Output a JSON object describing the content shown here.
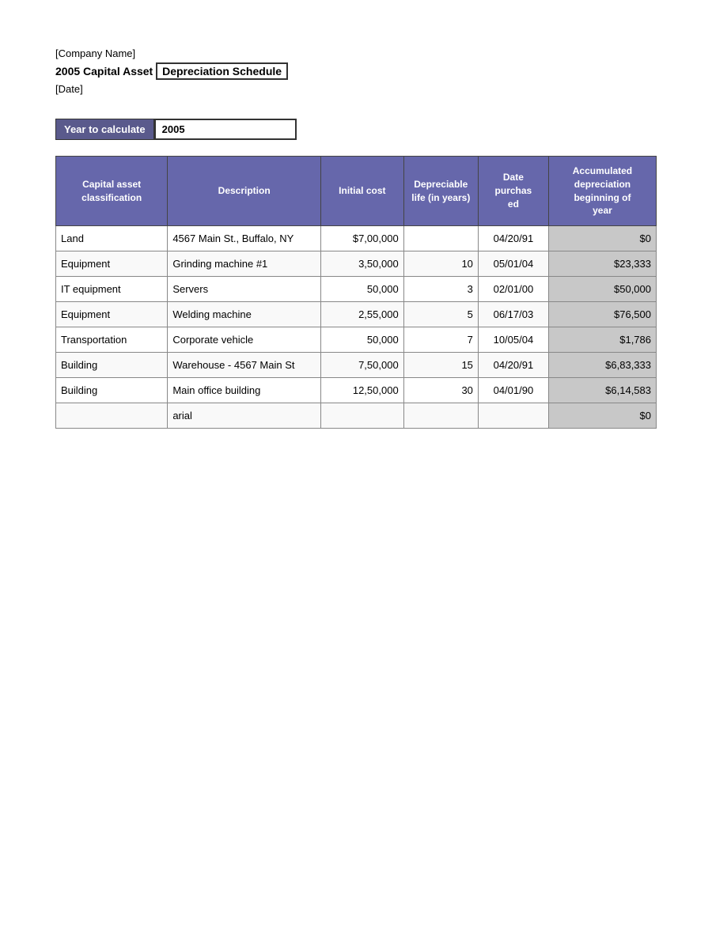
{
  "header": {
    "company_name": "[Company Name]",
    "report_title_prefix": "2005 Capital Asset",
    "report_title_box": "Depreciation Schedule",
    "report_date": "[Date]"
  },
  "year_section": {
    "label": "Year to calculate",
    "value": "2005"
  },
  "table": {
    "columns": [
      {
        "key": "classification",
        "label": "Capital asset classification"
      },
      {
        "key": "description",
        "label": "Description"
      },
      {
        "key": "initial_cost",
        "label": "Initial cost"
      },
      {
        "key": "depreciable_life",
        "label": "Depreciable life (in years)"
      },
      {
        "key": "date_purchased",
        "label": "Date purchased"
      },
      {
        "key": "accumulated",
        "label": "Accumulated depreciation beginning of year"
      }
    ],
    "rows": [
      {
        "classification": "Land",
        "description": "4567 Main St., Buffalo, NY",
        "initial_cost": "$7,00,000",
        "depreciable_life": "",
        "date_purchased": "04/20/91",
        "accumulated": "$0"
      },
      {
        "classification": "Equipment",
        "description": "Grinding machine #1",
        "initial_cost": "3,50,000",
        "depreciable_life": "10",
        "date_purchased": "05/01/04",
        "accumulated": "$23,333"
      },
      {
        "classification": "IT equipment",
        "description": "Servers",
        "initial_cost": "50,000",
        "depreciable_life": "3",
        "date_purchased": "02/01/00",
        "accumulated": "$50,000"
      },
      {
        "classification": "Equipment",
        "description": "Welding machine",
        "initial_cost": "2,55,000",
        "depreciable_life": "5",
        "date_purchased": "06/17/03",
        "accumulated": "$76,500"
      },
      {
        "classification": "Transportation",
        "description": "Corporate vehicle",
        "initial_cost": "50,000",
        "depreciable_life": "7",
        "date_purchased": "10/05/04",
        "accumulated": "$1,786"
      },
      {
        "classification": "Building",
        "description": "Warehouse - 4567 Main St",
        "initial_cost": "7,50,000",
        "depreciable_life": "15",
        "date_purchased": "04/20/91",
        "accumulated": "$6,83,333"
      },
      {
        "classification": "Building",
        "description": "Main office building",
        "initial_cost": "12,50,000",
        "depreciable_life": "30",
        "date_purchased": "04/01/90",
        "accumulated": "$6,14,583"
      },
      {
        "classification": "",
        "description": "arial",
        "initial_cost": "",
        "depreciable_life": "",
        "date_purchased": "",
        "accumulated": "$0"
      }
    ]
  }
}
